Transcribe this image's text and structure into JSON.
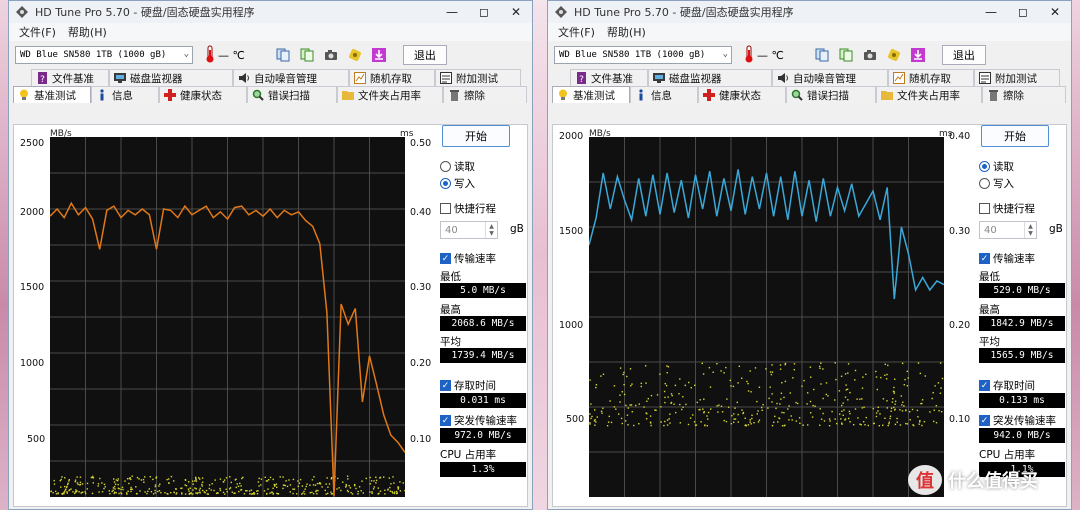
{
  "left": {
    "title": "HD Tune Pro 5.70 - 硬盘/固态硬盘实用程序",
    "menu": [
      "文件(F)",
      "帮助(H)"
    ],
    "drive": "WD Blue SN580 1TB (1000 gB)",
    "temp": "— ℃",
    "exit": "退出",
    "tabs_row1": [
      "文件基准",
      "磁盘监视器",
      "自动噪音管理",
      "随机存取",
      "附加测试"
    ],
    "tabs_row2": [
      "基准测试",
      "信息",
      "健康状态",
      "错误扫描",
      "文件夹占用率",
      "擦除"
    ],
    "active_tab": "基准测试",
    "start": "开始",
    "read": "读取",
    "write": "写入",
    "mode": "write",
    "short_stroke": "快捷行程",
    "short_stroke_value": "40",
    "short_stroke_unit": "gB",
    "transfer_rate": "传输速率",
    "min_label": "最低",
    "min_value": "5.0 MB/s",
    "max_label": "最高",
    "max_value": "2068.6 MB/s",
    "avg_label": "平均",
    "avg_value": "1739.4 MB/s",
    "access_label": "存取时间",
    "access_value": "0.031 ms",
    "burst_label": "突发传输速率",
    "burst_value": "972.0 MB/s",
    "cpu_label": "CPU 占用率",
    "cpu_value": "1.3%",
    "y_unit": "MB/s",
    "y2_unit": "ms",
    "y_ticks": [
      "2500",
      "2000",
      "1500",
      "1000",
      "500"
    ],
    "y2_ticks": [
      "0.50",
      "0.40",
      "0.30",
      "0.20",
      "0.10"
    ],
    "line_color": "#e07818"
  },
  "right": {
    "title": "HD Tune Pro 5.70 - 硬盘/固态硬盘实用程序",
    "menu": [
      "文件(F)",
      "帮助(H)"
    ],
    "drive": "WD Blue SN580 1TB (1000 gB)",
    "temp": "— ℃",
    "exit": "退出",
    "tabs_row1": [
      "文件基准",
      "磁盘监视器",
      "自动噪音管理",
      "随机存取",
      "附加测试"
    ],
    "tabs_row2": [
      "基准测试",
      "信息",
      "健康状态",
      "错误扫描",
      "文件夹占用率",
      "擦除"
    ],
    "active_tab": "基准测试",
    "start": "开始",
    "read": "读取",
    "write": "写入",
    "mode": "read",
    "short_stroke": "快捷行程",
    "short_stroke_value": "40",
    "short_stroke_unit": "gB",
    "transfer_rate": "传输速率",
    "min_label": "最低",
    "min_value": "529.0 MB/s",
    "max_label": "最高",
    "max_value": "1842.9 MB/s",
    "avg_label": "平均",
    "avg_value": "1565.9 MB/s",
    "access_label": "存取时间",
    "access_value": "0.133 ms",
    "burst_label": "突发传输速率",
    "burst_value": "942.0 MB/s",
    "cpu_label": "CPU 占用率",
    "cpu_value": "1.1%",
    "y_unit": "MB/s",
    "y2_unit": "ms",
    "y_ticks": [
      "2000",
      "1500",
      "1000",
      "500"
    ],
    "y2_ticks": [
      "0.40",
      "0.30",
      "0.20",
      "0.10"
    ],
    "line_color": "#3aa8d8"
  },
  "watermark": "什么值得买",
  "chart_data": [
    {
      "type": "line",
      "title": "",
      "xlabel": "",
      "ylabel": "MB/s",
      "y2label": "ms",
      "ylim": [
        0,
        2500
      ],
      "y2lim": [
        0,
        0.5
      ],
      "x_range": [
        0,
        100
      ],
      "series": [
        {
          "name": "写入",
          "x": [
            0,
            2,
            4,
            6,
            8,
            10,
            12,
            14,
            16,
            18,
            20,
            22,
            24,
            26,
            28,
            30,
            32,
            34,
            36,
            38,
            40,
            42,
            44,
            46,
            48,
            50,
            52,
            54,
            56,
            58,
            60,
            62,
            64,
            66,
            68,
            70,
            72,
            74,
            76,
            78,
            80,
            82,
            84,
            86,
            88,
            90,
            92,
            94,
            96,
            98,
            100
          ],
          "values": [
            1950,
            2000,
            1940,
            2040,
            1960,
            2010,
            1930,
            1720,
            1990,
            2020,
            1940,
            1990,
            1960,
            2000,
            1960,
            1720,
            2000,
            1990,
            1940,
            2020,
            1960,
            1990,
            2020,
            1940,
            1980,
            1930,
            2010,
            2020,
            1960,
            1990,
            1950,
            2000,
            1940,
            1990,
            1960,
            1980,
            1920,
            1880,
            1760,
            1280,
            5,
            1340,
            1200,
            1310,
            660,
            980,
            780,
            570,
            430,
            380,
            310
          ]
        }
      ],
      "access_points": "scatter of access time samples ≈ 0.01–0.03 ms"
    },
    {
      "type": "line",
      "title": "",
      "xlabel": "",
      "ylabel": "MB/s",
      "y2label": "ms",
      "ylim": [
        0,
        2000
      ],
      "y2lim": [
        0,
        0.4
      ],
      "x_range": [
        0,
        100
      ],
      "series": [
        {
          "name": "读取",
          "x": [
            0,
            2,
            4,
            6,
            8,
            10,
            12,
            14,
            16,
            18,
            20,
            22,
            24,
            26,
            28,
            30,
            32,
            34,
            36,
            38,
            40,
            42,
            44,
            46,
            48,
            50,
            52,
            54,
            56,
            58,
            60,
            62,
            64,
            66,
            68,
            70,
            72,
            74,
            76,
            78,
            80,
            82,
            84,
            86,
            88,
            90,
            92,
            94,
            96,
            98,
            100
          ],
          "values": [
            1400,
            1550,
            1800,
            1600,
            1780,
            1650,
            1540,
            1770,
            1560,
            1790,
            1570,
            1800,
            1580,
            1760,
            1550,
            1790,
            1600,
            1810,
            1560,
            1770,
            1590,
            1820,
            1570,
            1780,
            1600,
            1800,
            1560,
            1780,
            1540,
            1810,
            1560,
            1760,
            1530,
            1770,
            1560,
            1720,
            1590,
            1740,
            1560,
            1630,
            1700,
            1540,
            1720,
            1100,
            1500,
            1350,
            1150,
            1220,
            1150,
            1200,
            1180
          ]
        }
      ],
      "access_points": "scatter of access time samples ≈ 0.08–0.15 ms"
    }
  ]
}
